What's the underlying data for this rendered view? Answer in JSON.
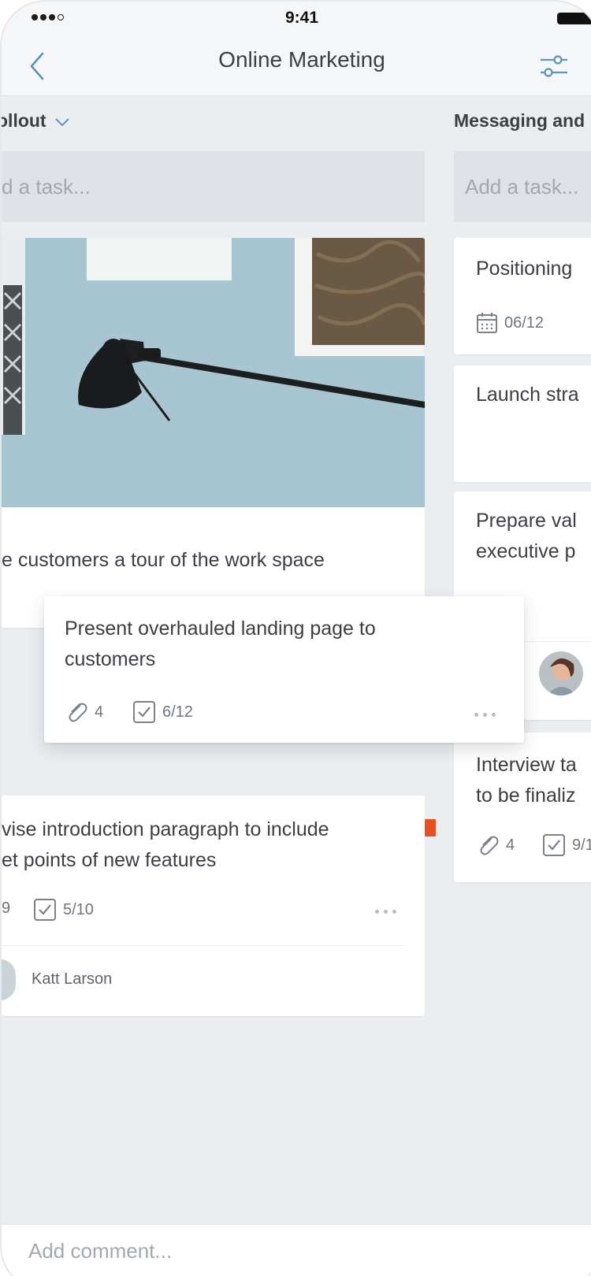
{
  "status_bar": {
    "time": "9:41"
  },
  "nav": {
    "title": "Online Marketing",
    "back_icon": "chevron-left-icon",
    "filter_icon": "sliders-icon"
  },
  "columns": [
    {
      "title": "ollout",
      "add_task_placeholder": "d a task...",
      "cards": [
        {
          "type": "image",
          "text": "e customers a tour of the work space"
        },
        {
          "lines": [
            "vise introduction paragraph to include",
            "et points of new features"
          ],
          "attachments": "9",
          "checklist": "5/10",
          "assignee": "Katt Larson",
          "label_color": "#e8501f"
        }
      ]
    },
    {
      "title": "Messaging and",
      "add_task_placeholder": "Add a task...",
      "cards": [
        {
          "lines": [
            "Positioning"
          ],
          "due_date": "06/12"
        },
        {
          "lines": [
            "Launch stra"
          ]
        },
        {
          "lines": [
            "Prepare val",
            "executive p"
          ]
        },
        {
          "lines": [
            "Interview ta",
            "to be finaliz"
          ],
          "attachments": "4",
          "checklist": "9/1"
        }
      ]
    }
  ],
  "dragged_card": {
    "lines": [
      "Present overhauled landing page to",
      "customers"
    ],
    "attachments": "4",
    "checklist": "6/12"
  },
  "comment": {
    "placeholder": "Add comment..."
  }
}
